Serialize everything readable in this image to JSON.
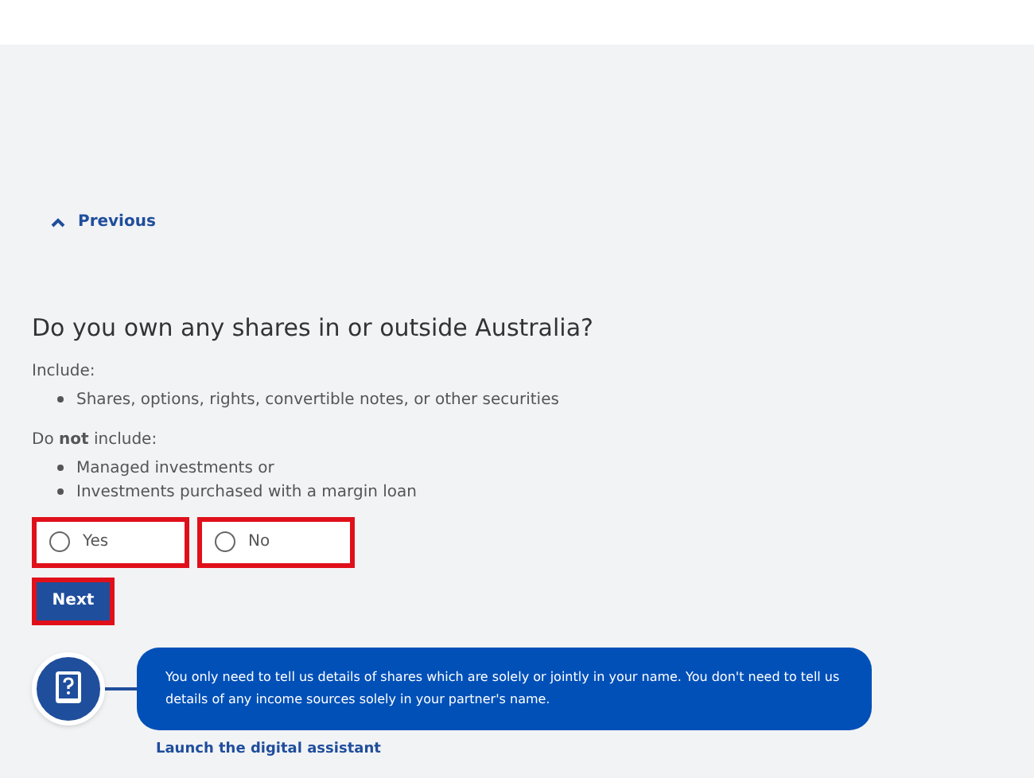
{
  "previous_link": "Previous",
  "question": "Do you own any shares in or outside Australia?",
  "include": {
    "label": "Include:",
    "items": [
      "Shares, options, rights, convertible notes, or other securities"
    ]
  },
  "exclude": {
    "label": "Do **not** include:",
    "items": [
      "Managed investments or",
      "Investments purchased with a margin loan"
    ]
  },
  "options": [
    {
      "label": "Yes",
      "selected": false,
      "highlighted": true
    },
    {
      "label": "No",
      "selected": false,
      "highlighted": true
    }
  ],
  "next_button": {
    "label": "Next",
    "highlighted": true
  },
  "assistant": {
    "message": "You only need to tell us details of shares which are solely or jointly in your name. You don't need to tell us details of any income sources solely in your partner's name.",
    "link": "Launch the digital assistant"
  }
}
